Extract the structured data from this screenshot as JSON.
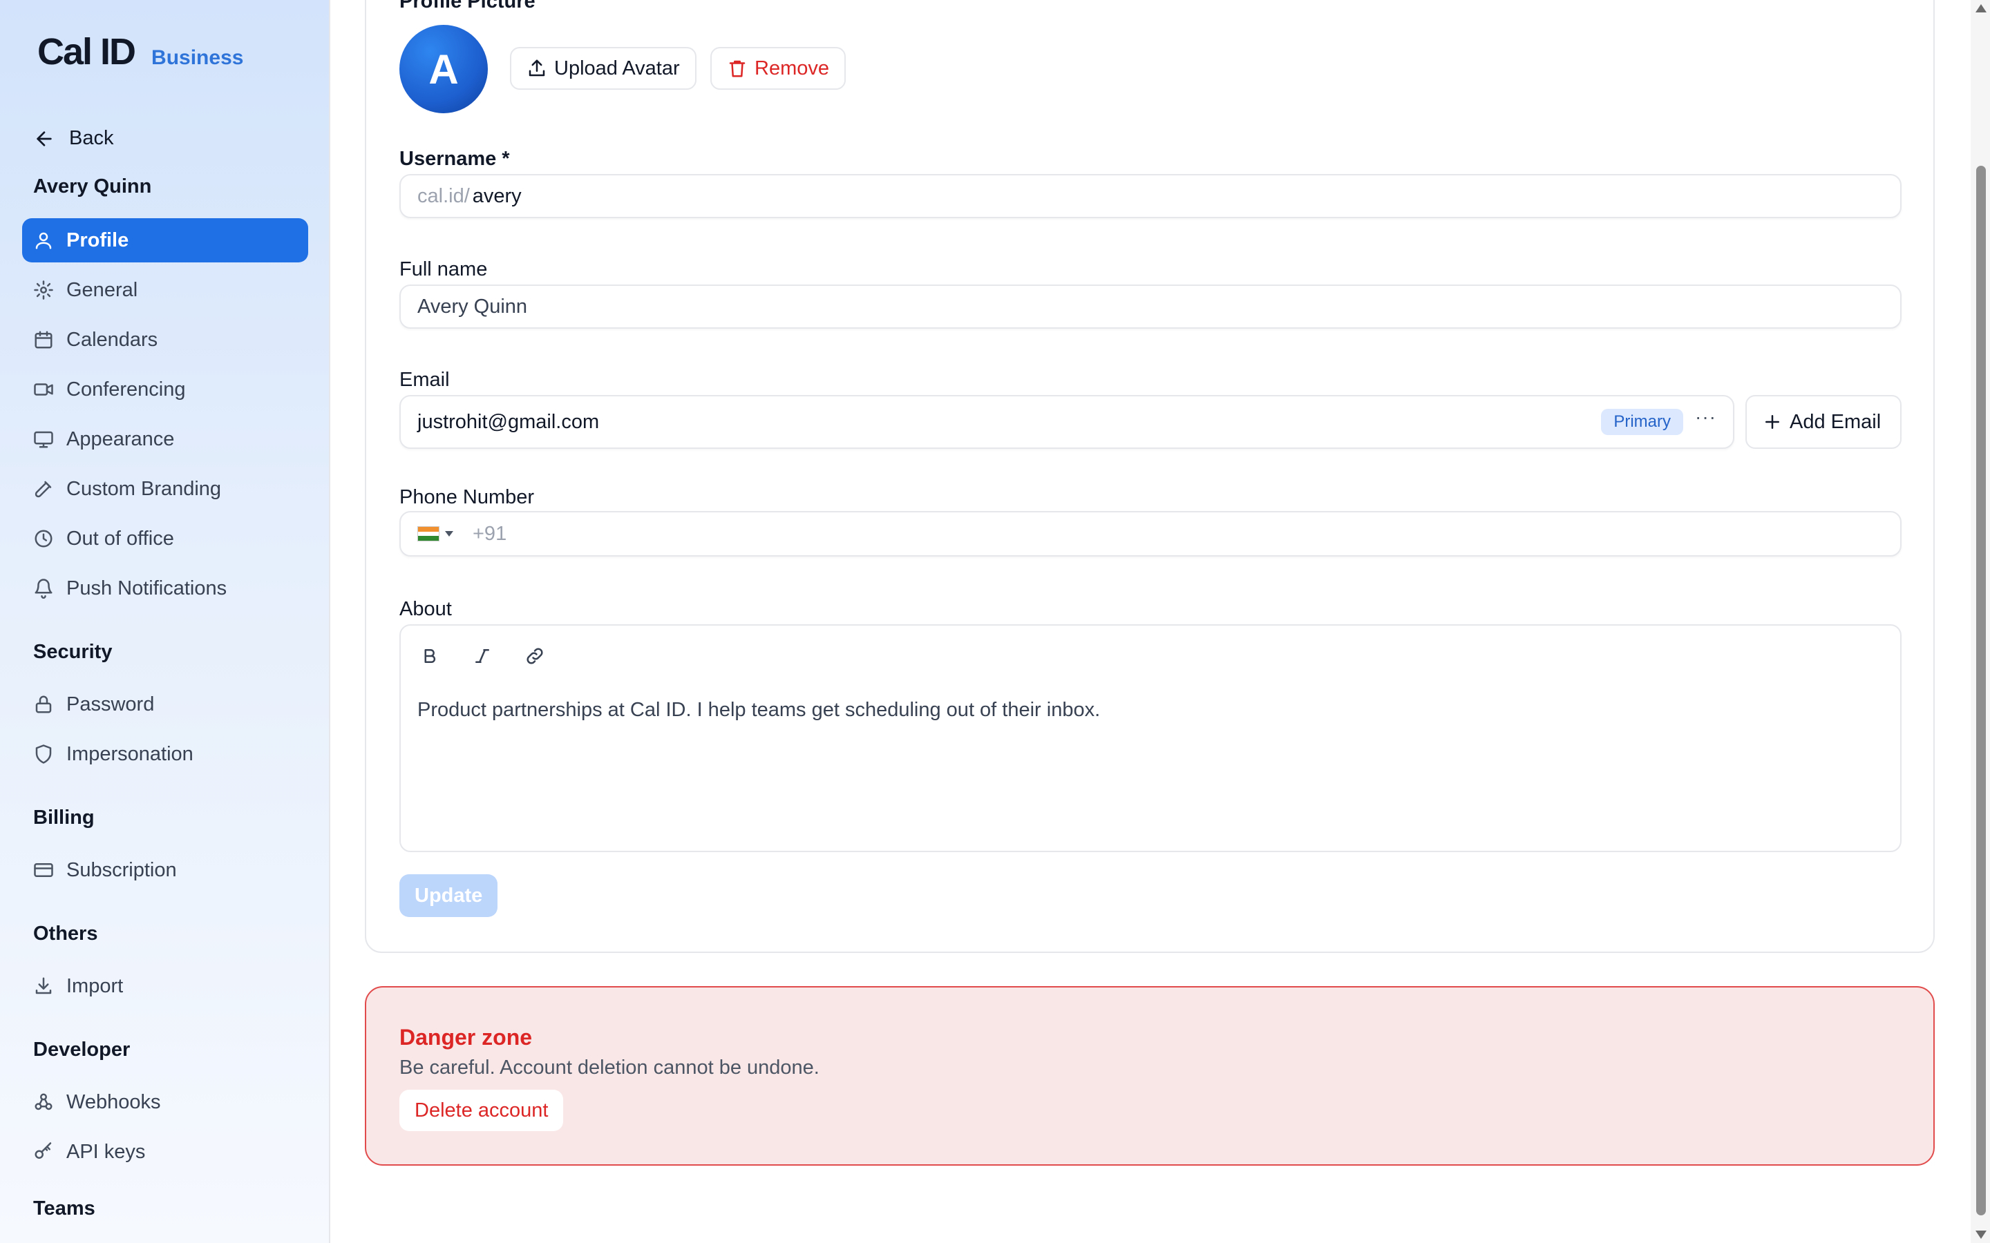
{
  "brand": {
    "logo": "Cal ID",
    "tag": "Business"
  },
  "sidebar": {
    "back_label": "Back",
    "user_name": "Avery Quinn",
    "items": [
      {
        "label": "Profile",
        "icon": "user-icon",
        "active": true
      },
      {
        "label": "General",
        "icon": "gear-icon"
      },
      {
        "label": "Calendars",
        "icon": "calendar-icon"
      },
      {
        "label": "Conferencing",
        "icon": "video-icon"
      },
      {
        "label": "Appearance",
        "icon": "monitor-icon"
      },
      {
        "label": "Custom Branding",
        "icon": "brush-icon"
      },
      {
        "label": "Out of office",
        "icon": "clock-icon"
      },
      {
        "label": "Push Notifications",
        "icon": "bell-icon"
      }
    ],
    "security": {
      "heading": "Security",
      "items": [
        {
          "label": "Password",
          "icon": "lock-icon"
        },
        {
          "label": "Impersonation",
          "icon": "shield-icon"
        }
      ]
    },
    "billing": {
      "heading": "Billing",
      "items": [
        {
          "label": "Subscription",
          "icon": "credit-card-icon"
        }
      ]
    },
    "others": {
      "heading": "Others",
      "items": [
        {
          "label": "Import",
          "icon": "download-icon"
        }
      ]
    },
    "developer": {
      "heading": "Developer",
      "items": [
        {
          "label": "Webhooks",
          "icon": "webhook-icon"
        },
        {
          "label": "API keys",
          "icon": "key-icon"
        }
      ]
    },
    "teams": {
      "heading": "Teams"
    }
  },
  "profile": {
    "picture_label": "Profile Picture",
    "avatar_letter": "A",
    "upload_label": "Upload Avatar",
    "remove_label": "Remove",
    "username_label": "Username *",
    "username_prefix": "cal.id/",
    "username_value": "avery",
    "fullname_label": "Full name",
    "fullname_value": "Avery Quinn",
    "email_label": "Email",
    "email_value": "justrohit@gmail.com",
    "email_badge": "Primary",
    "email_more": "···",
    "add_email_label": "Add Email",
    "phone_label": "Phone Number",
    "phone_placeholder": "+91",
    "about_label": "About",
    "about_value": "Product partnerships at Cal ID. I help teams get scheduling out of their inbox.",
    "update_label": "Update"
  },
  "danger": {
    "title": "Danger zone",
    "subtitle": "Be careful. Account deletion cannot be undone.",
    "delete_label": "Delete account"
  },
  "colors": {
    "accent": "#1f6fe5",
    "danger": "#dc2626",
    "badge_bg": "#dbe8fd"
  }
}
